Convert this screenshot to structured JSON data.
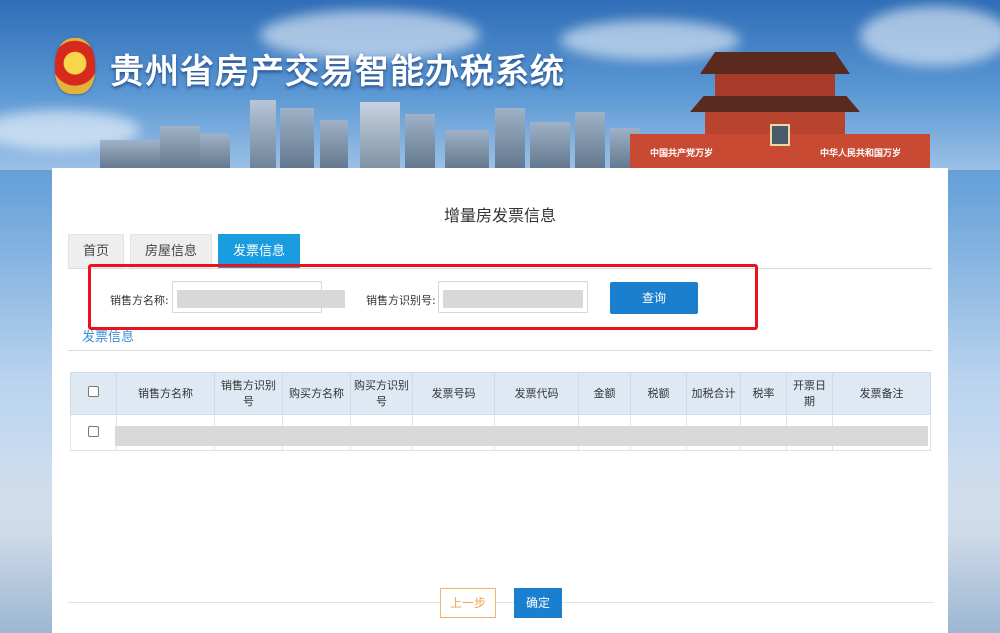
{
  "app": {
    "system_title": "贵州省房产交易智能办税系统"
  },
  "banner": {
    "slogan_left": "中国共产党万岁",
    "slogan_right": "中华人民共和国万岁"
  },
  "page": {
    "title": "增量房发票信息"
  },
  "tabs": [
    {
      "label": "首页",
      "active": false
    },
    {
      "label": "房屋信息",
      "active": false
    },
    {
      "label": "发票信息",
      "active": true
    }
  ],
  "query": {
    "seller_name_label": "销售方名称:",
    "seller_id_label": "销售方识别号:",
    "search_button": "查询",
    "highlight_color": "#e8141c"
  },
  "section": {
    "label": "发票信息"
  },
  "table": {
    "headers": [
      "销售方名称",
      "销售方识别号",
      "购买方名称",
      "购买方识别号",
      "发票号码",
      "发票代码",
      "金额",
      "税额",
      "加税合计",
      "税率",
      "开票日期",
      "发票备注"
    ]
  },
  "footer": {
    "prev_button": "上一步",
    "confirm_button": "确定"
  },
  "colors": {
    "primary": "#1a7fcf",
    "tab_active": "#1a9de0",
    "link": "#3a8ed8"
  }
}
